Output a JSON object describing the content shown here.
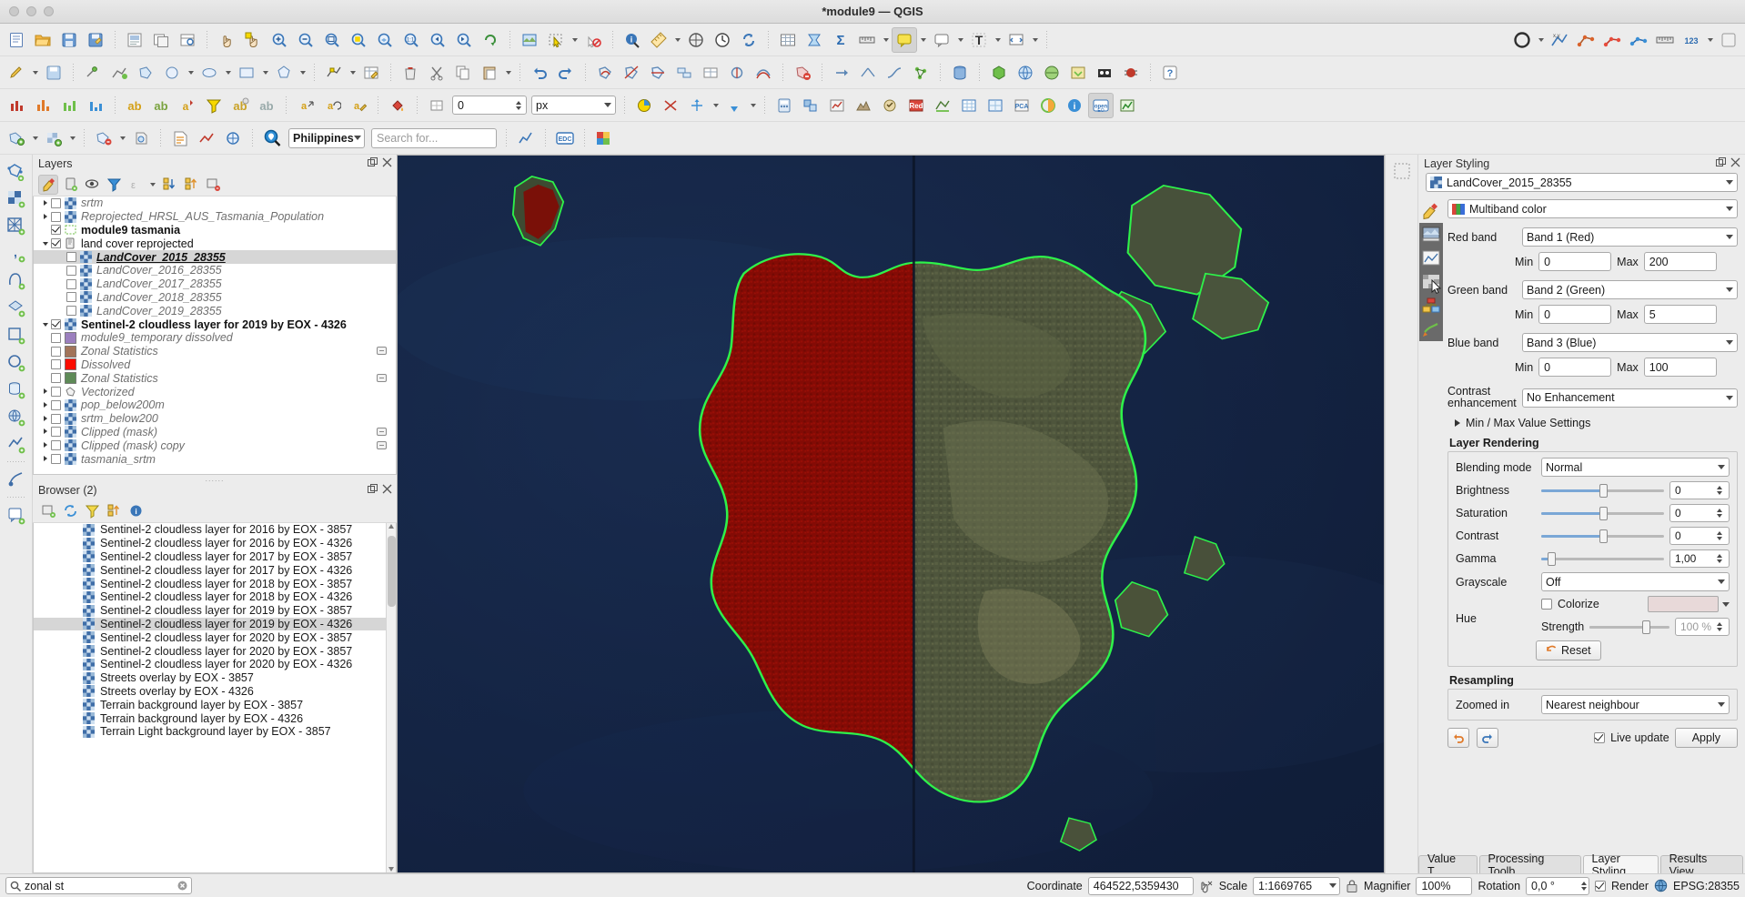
{
  "window": {
    "title": "*module9 — QGIS"
  },
  "toolbars": {
    "row1": [
      "new-project",
      "open-project",
      "save-project",
      "save-project-as",
      "new-print-layout",
      "layout-manager",
      "pan-map",
      "pan-to-selection",
      "zoom-in",
      "zoom-out",
      "zoom-full",
      "zoom-selection",
      "zoom-layer",
      "zoom-native",
      "zoom-last",
      "zoom-next",
      "refresh",
      "new-3d-map-view",
      "select-features",
      "deselect",
      "identify-features",
      "measure",
      "statistics",
      "open-attribute-table",
      "map-tips",
      "text-annotation",
      "annotations",
      "python-console",
      "show-style-manager"
    ],
    "row2": [
      "toggle-editing",
      "save-layer-edits",
      "add-feature",
      "move-feature",
      "node-tool",
      "delete-selected",
      "cut-features",
      "copy-features",
      "paste-features",
      "undo",
      "redo",
      "vertex-tool",
      "reshape",
      "split-features",
      "merge-features",
      "offset-curve",
      "simplify",
      "add-ring",
      "add-part",
      "fill-ring",
      "delete-ring",
      "delete-part",
      "rotate",
      "topological-editing",
      "snapping",
      "avoid-overlap",
      "enable-tracing",
      "digitize-circle",
      "georeferencer",
      "db-manager",
      "plugins",
      "metasearch",
      "openstreetmap",
      "osm-download",
      "processing-toolbox",
      "help"
    ],
    "row3": [
      "histogram",
      "graduated",
      "categorized",
      "rule-based",
      "heatmap",
      "inverted-polygon",
      "2.5d",
      "simple-marker",
      "labeling",
      "label-toggle",
      "label-highlight",
      "label-pin",
      "move-label",
      "rotate-label",
      "change-label",
      "offset-label",
      "unit-px",
      "size-value",
      "diagram",
      "show-pinned",
      "hide-labels",
      "show-unplaced",
      "raster-calculator",
      "align-raster",
      "zonal-statistics",
      "raster-terrain",
      "serval",
      "opencl",
      "red-layer",
      "temporal-controller",
      "mesh",
      "pca",
      "semi-automatic",
      "info",
      "openeo",
      "plot"
    ],
    "row4": [
      "add-vector-layer",
      "add-raster-layer",
      "add-mesh-layer",
      "add-delimited-text",
      "add-postgis",
      "add-spatialite",
      "add-wms",
      "add-wfs",
      "filter",
      "locator-search",
      "qgis2web",
      "edc-browser",
      "color-picker"
    ]
  },
  "layers_panel": {
    "title": "Layers",
    "tools": [
      "open-layer-styling-panel",
      "add-group",
      "manage-visibility",
      "filter-legend",
      "filter-legend-expression",
      "expand-all",
      "collapse-all",
      "remove-layer"
    ],
    "items": [
      {
        "label": "srtm",
        "style": "italic",
        "checked": false,
        "expandable": true,
        "indent": 0,
        "icon": "raster"
      },
      {
        "label": "Reprojected_HRSL_AUS_Tasmania_Population",
        "style": "italic",
        "checked": false,
        "expandable": true,
        "indent": 0,
        "icon": "raster"
      },
      {
        "label": "module9 tasmania",
        "style": "bold",
        "checked": true,
        "expandable": false,
        "indent": 0,
        "icon": "polygon-outline"
      },
      {
        "label": "land cover reprojected",
        "style": "plain",
        "checked": true,
        "expandable": true,
        "expanded": true,
        "indent": 0,
        "icon": "group"
      },
      {
        "label": "LandCover_2015_28355",
        "style": "selected",
        "checked": false,
        "expandable": false,
        "indent": 1,
        "icon": "raster",
        "selected": true
      },
      {
        "label": "LandCover_2016_28355",
        "style": "italic",
        "checked": false,
        "expandable": false,
        "indent": 1,
        "icon": "raster"
      },
      {
        "label": "LandCover_2017_28355",
        "style": "italic",
        "checked": false,
        "expandable": false,
        "indent": 1,
        "icon": "raster"
      },
      {
        "label": "LandCover_2018_28355",
        "style": "italic",
        "checked": false,
        "expandable": false,
        "indent": 1,
        "icon": "raster"
      },
      {
        "label": "LandCover_2019_28355",
        "style": "italic",
        "checked": false,
        "expandable": false,
        "indent": 1,
        "icon": "raster"
      },
      {
        "label": "Sentinel-2 cloudless layer for 2019 by EOX - 4326",
        "style": "bold",
        "checked": true,
        "expandable": true,
        "expanded": true,
        "indent": 0,
        "icon": "raster"
      },
      {
        "label": "module9_temporary dissolved",
        "style": "italic",
        "checked": false,
        "expandable": false,
        "indent": 0,
        "icon": "swatch",
        "swatch": "#9b7fbe"
      },
      {
        "label": "Zonal Statistics",
        "style": "italic",
        "checked": false,
        "expandable": false,
        "indent": 0,
        "icon": "swatch",
        "swatch": "#a2745a",
        "indicator": true
      },
      {
        "label": "Dissolved",
        "style": "italic",
        "checked": false,
        "expandable": false,
        "indent": 0,
        "icon": "swatch",
        "swatch": "#fc0d00"
      },
      {
        "label": "Zonal Statistics",
        "style": "italic",
        "checked": false,
        "expandable": false,
        "indent": 0,
        "icon": "swatch",
        "swatch": "#5e8a57",
        "indicator": true
      },
      {
        "label": "Vectorized",
        "style": "italic",
        "checked": false,
        "expandable": true,
        "indent": 0,
        "icon": "polygon"
      },
      {
        "label": "pop_below200m",
        "style": "italic",
        "checked": false,
        "expandable": true,
        "indent": 0,
        "icon": "raster"
      },
      {
        "label": "srtm_below200",
        "style": "italic",
        "checked": false,
        "expandable": true,
        "indent": 0,
        "icon": "raster"
      },
      {
        "label": "Clipped (mask)",
        "style": "italic",
        "checked": false,
        "expandable": true,
        "indent": 0,
        "icon": "raster",
        "indicator": true
      },
      {
        "label": "Clipped (mask) copy",
        "style": "italic",
        "checked": false,
        "expandable": true,
        "indent": 0,
        "icon": "raster",
        "indicator": true
      },
      {
        "label": "tasmania_srtm",
        "style": "italic",
        "checked": false,
        "expandable": true,
        "indent": 0,
        "icon": "raster"
      }
    ]
  },
  "browser_panel": {
    "title": "Browser (2)",
    "tools": [
      "add-selected-layers",
      "refresh",
      "filter-browser",
      "collapse-all",
      "properties"
    ],
    "items": [
      {
        "label": "Sentinel-2 cloudless layer for 2016 by EOX - 3857"
      },
      {
        "label": "Sentinel-2 cloudless layer for 2016 by EOX - 4326"
      },
      {
        "label": "Sentinel-2 cloudless layer for 2017 by EOX - 3857"
      },
      {
        "label": "Sentinel-2 cloudless layer for 2017 by EOX - 4326"
      },
      {
        "label": "Sentinel-2 cloudless layer for 2018 by EOX - 3857"
      },
      {
        "label": "Sentinel-2 cloudless layer for 2018 by EOX - 4326"
      },
      {
        "label": "Sentinel-2 cloudless layer for 2019 by EOX - 3857"
      },
      {
        "label": "Sentinel-2 cloudless layer for 2019 by EOX - 4326",
        "selected": true
      },
      {
        "label": "Sentinel-2 cloudless layer for 2020 by EOX - 3857"
      },
      {
        "label": "Sentinel-2 cloudless layer for 2020 by EOX - 3857"
      },
      {
        "label": "Sentinel-2 cloudless layer for 2020 by EOX - 4326"
      },
      {
        "label": "Streets overlay by EOX - 3857"
      },
      {
        "label": "Streets overlay by EOX - 4326"
      },
      {
        "label": "Terrain background layer by EOX - 3857"
      },
      {
        "label": "Terrain background layer by EOX - 4326"
      },
      {
        "label": "Terrain Light background layer by EOX - 3857"
      }
    ]
  },
  "project_selector": {
    "value": "Philippines"
  },
  "search_field": {
    "placeholder": "Search for..."
  },
  "layer_styling": {
    "title": "Layer Styling",
    "layer_combo": "LandCover_2015_28355",
    "renderer_label": "Multiband color",
    "side_tabs": [
      "symbology",
      "transparency",
      "histogram",
      "rendering",
      "pyramids",
      "metadata"
    ],
    "red_band": {
      "label": "Red band",
      "value": "Band 1 (Red)",
      "min_label": "Min",
      "min": "0",
      "max_label": "Max",
      "max": "200"
    },
    "green_band": {
      "label": "Green band",
      "value": "Band 2 (Green)",
      "min_label": "Min",
      "min": "0",
      "max_label": "Max",
      "max": "5"
    },
    "blue_band": {
      "label": "Blue band",
      "value": "Band 3 (Blue)",
      "min_label": "Min",
      "min": "0",
      "max_label": "Max",
      "max": "100"
    },
    "contrast": {
      "label": "Contrast enhancement",
      "value": "No Enhancement"
    },
    "minmax_settings": "Min / Max Value Settings",
    "layer_rendering": {
      "title": "Layer Rendering",
      "blending_label": "Blending mode",
      "blending_value": "Normal",
      "brightness_label": "Brightness",
      "brightness_value": "0",
      "brightness_pct": 50,
      "saturation_label": "Saturation",
      "saturation_value": "0",
      "saturation_pct": 50,
      "contrast_label": "Contrast",
      "contrast_value": "0",
      "contrast_pct": 50,
      "gamma_label": "Gamma",
      "gamma_value": "1,00",
      "gamma_pct": 8,
      "grayscale_label": "Grayscale",
      "grayscale_value": "Off",
      "hue_label": "Hue",
      "colorize_label": "Colorize",
      "colorize_checked": false,
      "strength_label": "Strength",
      "strength_value": "100 %",
      "strength_pct": 70,
      "reset_label": "Reset"
    },
    "resampling": {
      "title": "Resampling",
      "zoomed_in_label": "Zoomed in",
      "zoomed_in_value": "Nearest neighbour"
    },
    "live_update_label": "Live update",
    "live_update_checked": true,
    "apply_label": "Apply",
    "tabs": [
      {
        "label": "Value T...",
        "active": false
      },
      {
        "label": "Processing Toolb...",
        "active": false
      },
      {
        "label": "Layer Styling",
        "active": true
      },
      {
        "label": "Results View...",
        "active": false
      }
    ]
  },
  "statusbar": {
    "locator_value": "zonal st",
    "coordinate_label": "Coordinate",
    "coordinate_value": "464522,5359430",
    "scale_label": "Scale",
    "scale_value": "1:1669765",
    "magnifier_label": "Magnifier",
    "magnifier_value": "100%",
    "rotation_label": "Rotation",
    "rotation_value": "0,0 °",
    "render_label": "Render",
    "render_checked": true,
    "crs_value": "EPSG:28355"
  },
  "colors": {
    "accent": "#3a76b8",
    "land_red": "#8b0d06",
    "ocean": "#14253f",
    "coastline_green": "#2ef24a"
  }
}
